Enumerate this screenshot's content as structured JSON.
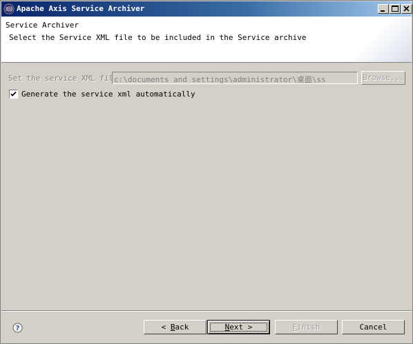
{
  "window": {
    "title": "Apache Axis Service Archiver"
  },
  "banner": {
    "title": "Service Archiver",
    "description": "Select the Service XML file to be included in the Service archive"
  },
  "form": {
    "xml_label": "Set the service XML file",
    "xml_path": "c:\\documents and settings\\administrator\\桌面\\ss",
    "browse_label": "Browse...",
    "generate_label": "Generate the service xml automatically",
    "generate_checked": true
  },
  "footer": {
    "back_prefix": "< ",
    "back_mnemonic": "B",
    "back_rest": "ack",
    "next_mnemonic": "N",
    "next_rest": "ext >",
    "finish_mnemonic": "F",
    "finish_rest": "inish",
    "cancel_label": "Cancel"
  },
  "icons": {
    "app": "eclipse-icon",
    "minimize": "minimize-icon",
    "maximize": "maximize-icon",
    "close": "close-icon",
    "help": "help-icon",
    "check": "check-icon"
  },
  "colors": {
    "titlebar_start": "#0a246a",
    "titlebar_end": "#a6caf0",
    "dialog_bg": "#d4d0c8"
  }
}
